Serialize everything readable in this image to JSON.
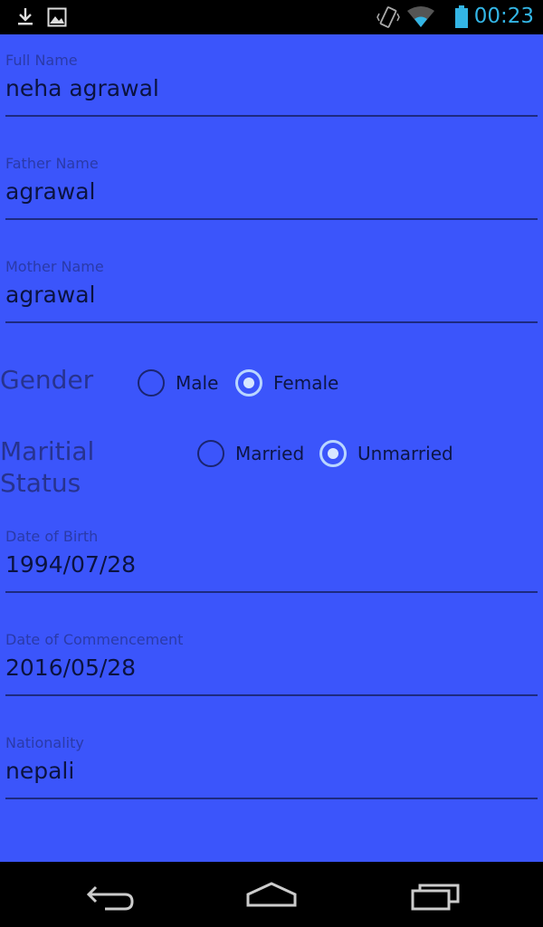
{
  "status_bar": {
    "time": "00:23",
    "icons": [
      "download-icon",
      "image-icon",
      "vibrate-icon",
      "wifi-icon",
      "battery-icon"
    ]
  },
  "form": {
    "full_name": {
      "label": "Full Name",
      "value": "neha agrawal"
    },
    "father_name": {
      "label": "Father Name",
      "value": "agrawal"
    },
    "mother_name": {
      "label": "Mother Name",
      "value": "agrawal"
    },
    "gender": {
      "label": "Gender",
      "options": [
        {
          "label": "Male",
          "checked": false
        },
        {
          "label": "Female",
          "checked": true
        }
      ]
    },
    "marital_status": {
      "label_line1": "Maritial",
      "label_line2": "Status",
      "options": [
        {
          "label": "Married",
          "checked": false
        },
        {
          "label": "Unmarried",
          "checked": true
        }
      ]
    },
    "date_of_birth": {
      "label": "Date of Birth",
      "value": "1994/07/28"
    },
    "date_of_commencement": {
      "label": "Date of Commencement",
      "value": "2016/05/28"
    },
    "nationality": {
      "label": "Nationality",
      "value": "nepali"
    }
  },
  "nav_bar": {
    "buttons": [
      "back-icon",
      "home-icon",
      "recent-apps-icon"
    ]
  },
  "colors": {
    "form_background": "#3b55fb",
    "status_time": "#33b5e5"
  }
}
